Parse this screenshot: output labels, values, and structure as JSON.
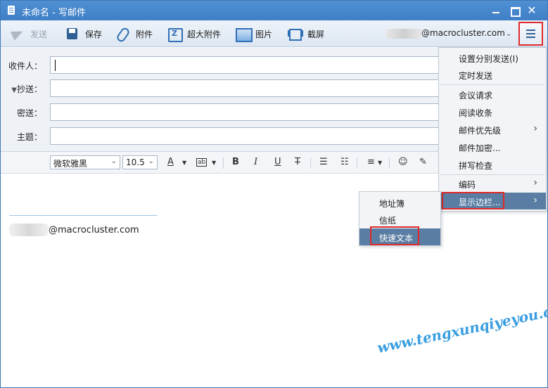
{
  "window": {
    "title": "未命名 - 写邮件"
  },
  "toolbar": {
    "send": "发送",
    "save": "保存",
    "attach": "附件",
    "big_attach": "超大附件",
    "picture": "图片",
    "screenshot": "截屏"
  },
  "account": {
    "suffix": "@macrocluster.com"
  },
  "fields": {
    "to_label": "收件人：",
    "cc_label": "抄送：",
    "bcc_label": "密送：",
    "subject_label": "主题：",
    "to_value": "",
    "cc_value": "",
    "bcc_value": "",
    "subject_value": ""
  },
  "format": {
    "font": "微软雅黑",
    "size": "10.5"
  },
  "editor": {
    "signature_suffix": "@macrocluster.com"
  },
  "menu": {
    "items": [
      {
        "label": "设置分别发送(I)"
      },
      {
        "label": "定时发送"
      },
      {
        "label": "会议请求"
      },
      {
        "label": "阅读收条"
      },
      {
        "label": "邮件优先级"
      },
      {
        "label": "邮件加密..."
      },
      {
        "label": "拼写检查"
      },
      {
        "label": "编码"
      },
      {
        "label": "显示边栏..."
      }
    ]
  },
  "submenu": {
    "items": [
      {
        "label": "地址簿"
      },
      {
        "label": "信纸"
      },
      {
        "label": "快速文本"
      }
    ]
  },
  "watermark": "www.tengxunqiyeyou.com",
  "colors": {
    "titlebar": "#3f7fc6",
    "highlight": "#5a7ea3",
    "annotation": "#e02a2a",
    "watermark": "#3a9ee0"
  }
}
